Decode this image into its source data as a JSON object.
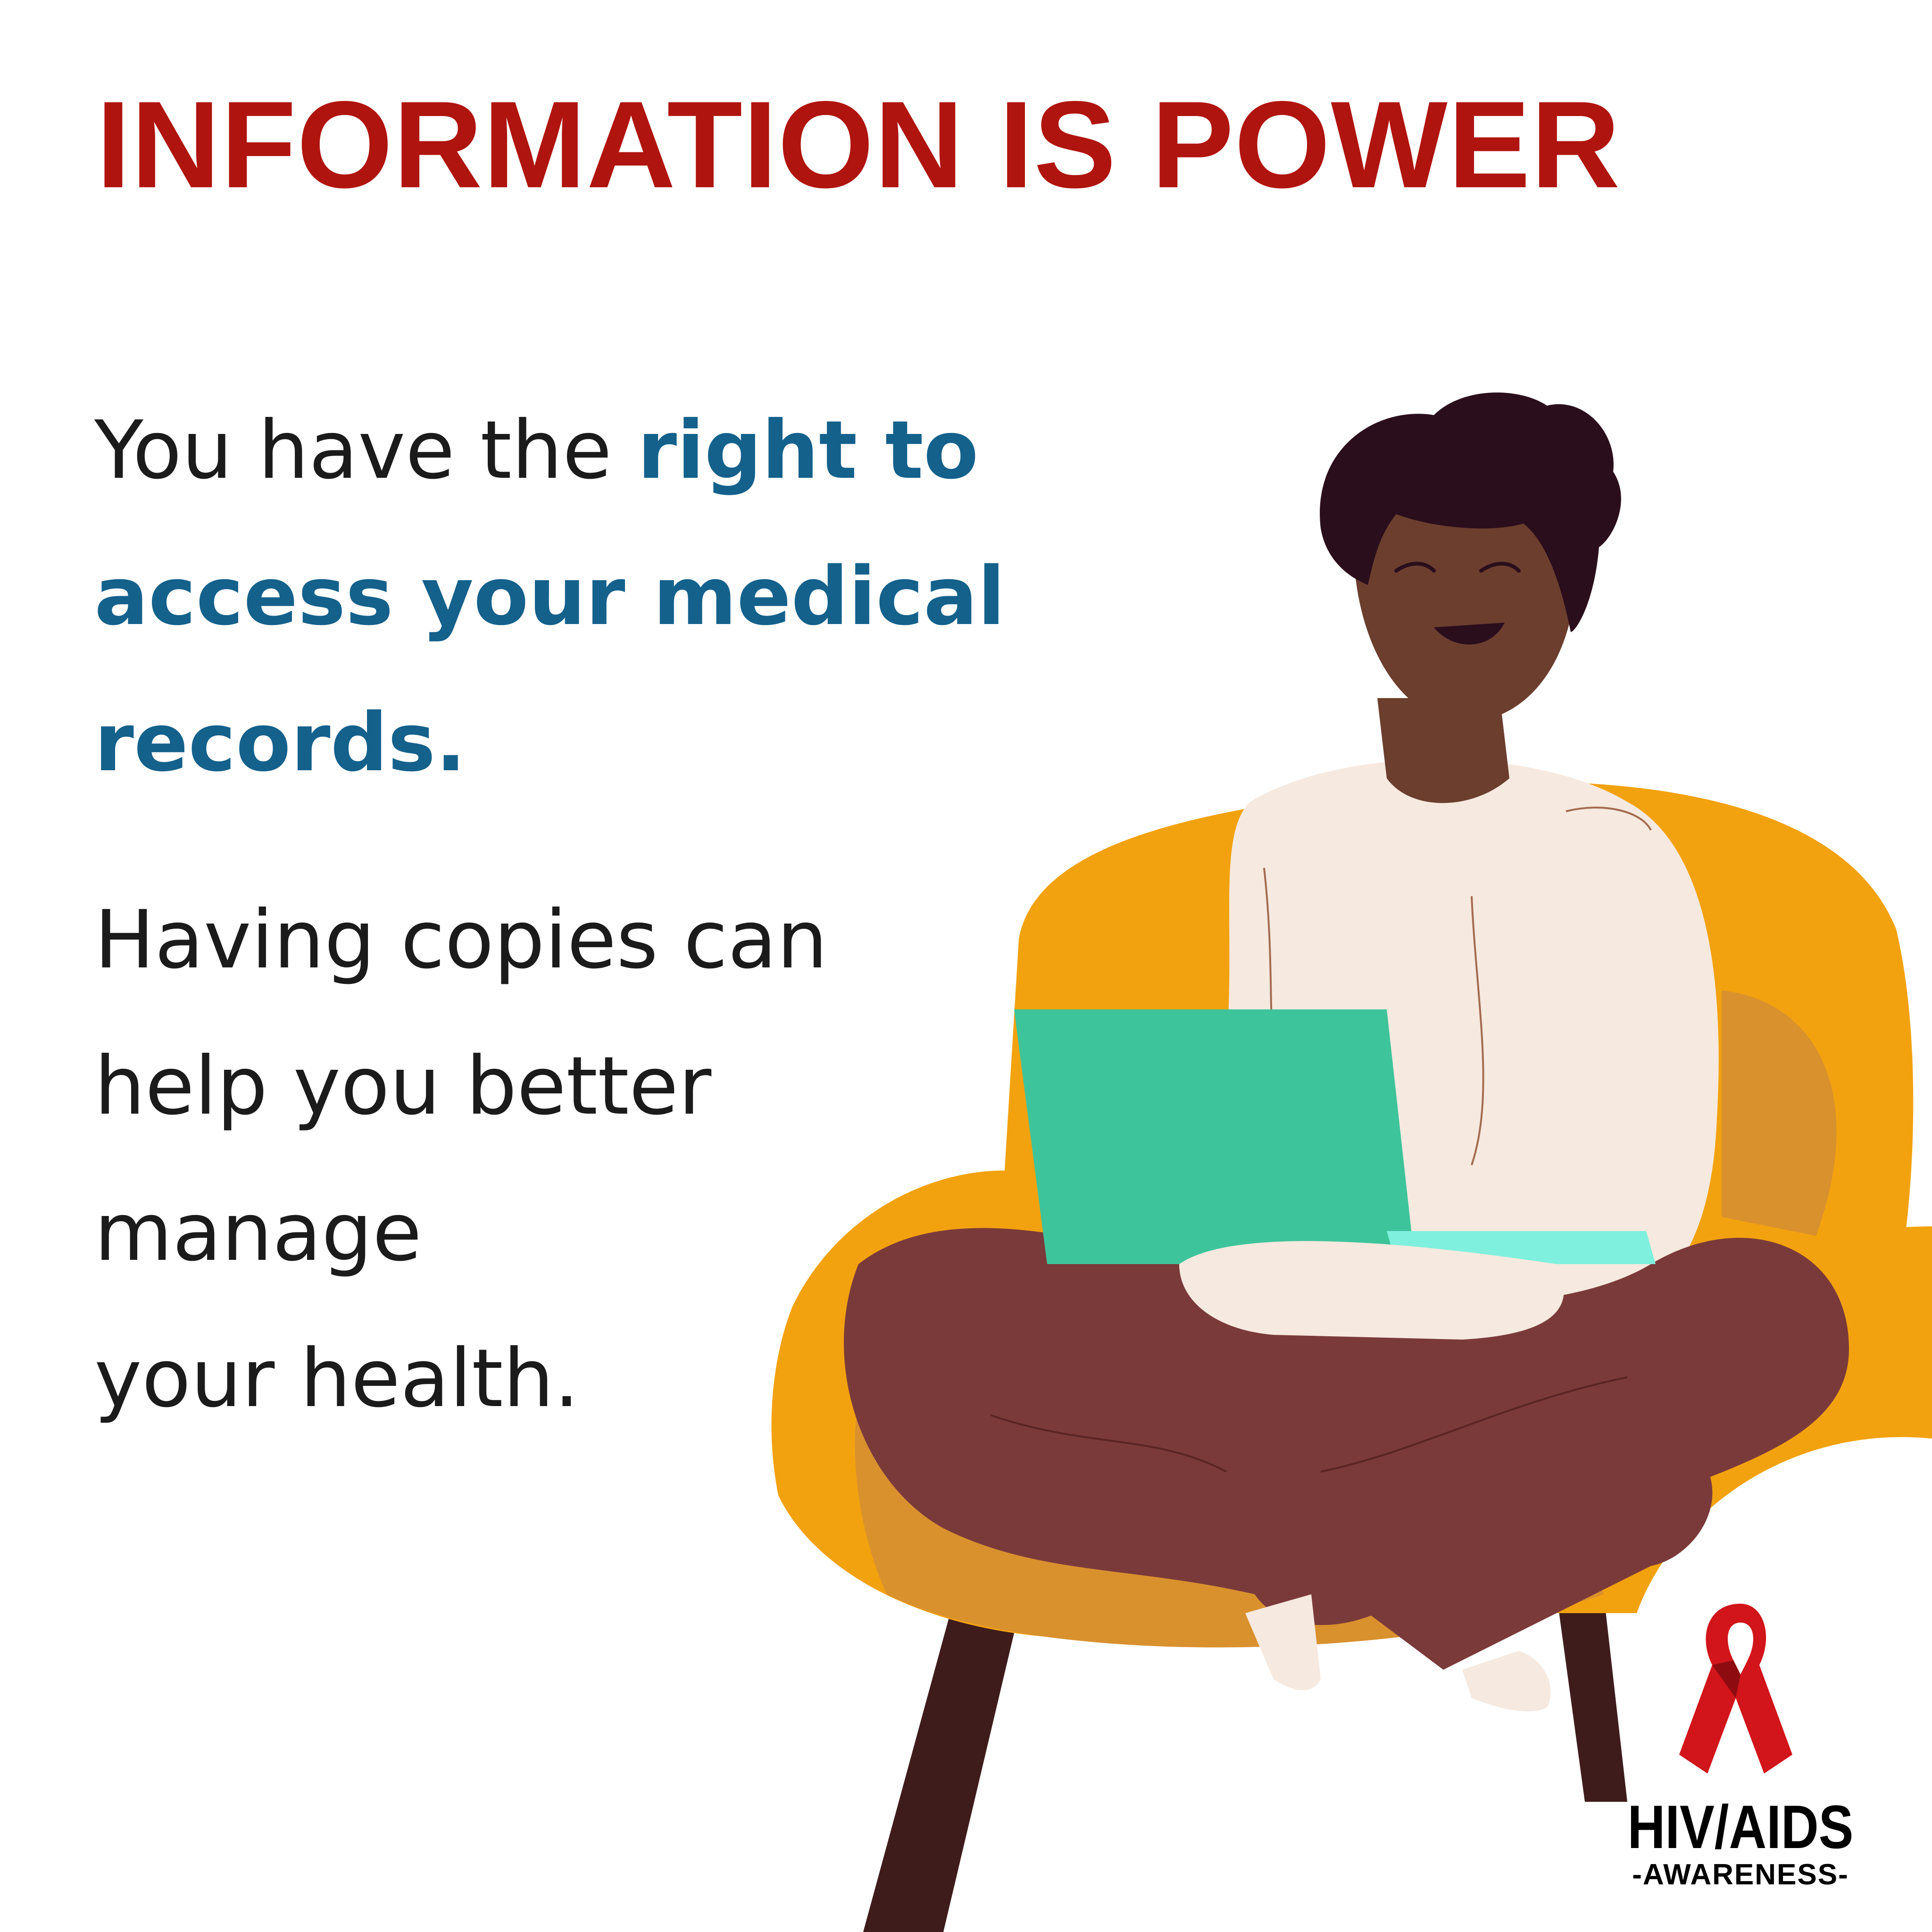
{
  "headline": {
    "text": "INFORMATION IS POWER",
    "color": "#b0140f"
  },
  "paragraph_1": {
    "lead": "You have the ",
    "highlight_line_1": "right to",
    "highlight_line_2": "access your medical",
    "highlight_line_3": "records.",
    "text_color": "#1b1b1b",
    "highlight_color": "#14618c"
  },
  "paragraph_2": {
    "lines": [
      "Having copies can",
      "help you better",
      "manage",
      "your health."
    ],
    "text_color": "#1b1b1b"
  },
  "logo": {
    "title": "HIV/AIDS",
    "subtitle": "-AWARENESS-",
    "icon": "red-ribbon-icon",
    "ribbon_color": "#d1151a"
  },
  "illustration": {
    "icon": "person-with-laptop-on-armchair-icon",
    "colors": {
      "chair": "#f2a20f",
      "chair_shade": "#d9912e",
      "skin": "#6b3e2e",
      "hair": "#2b0e1c",
      "sweater": "#f6e9df",
      "pants": "#7b3a3a",
      "laptop": "#3ec49b",
      "laptop_base": "#7ff0dd",
      "chair_leg": "#3f1c1c"
    }
  }
}
